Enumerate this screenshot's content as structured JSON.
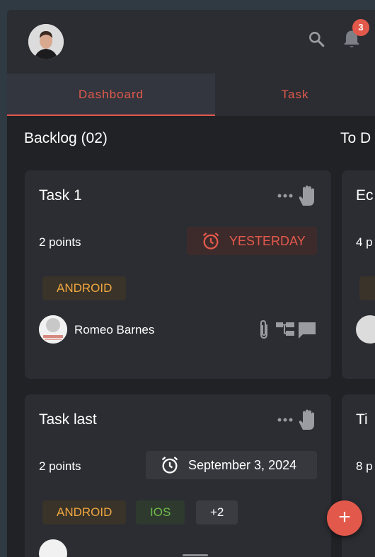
{
  "header": {
    "notification_count": "3",
    "tabs": [
      {
        "label": "Dashboard",
        "active": true
      },
      {
        "label": "Task",
        "active": false
      }
    ]
  },
  "columns": [
    {
      "title": "Backlog (02)"
    },
    {
      "title": "To D"
    }
  ],
  "cards": [
    {
      "title": "Task 1",
      "points": "2 points",
      "due": "YESTERDAY",
      "due_status": "overdue",
      "tags": [
        "ANDROID"
      ],
      "assignee": "Romeo Barnes"
    },
    {
      "title": "Task last",
      "points": "2 points",
      "due": "September 3, 2024",
      "due_status": "normal",
      "tags": [
        "ANDROID",
        "IOS",
        "+2"
      ]
    }
  ],
  "peek_cards": [
    {
      "title": "Ec",
      "points": "4 p"
    },
    {
      "title": "Ti",
      "points": "8 p"
    }
  ],
  "fab_label": "+",
  "colors": {
    "accent": "#e2594c",
    "android": "#f0a840",
    "ios": "#6fbd4b",
    "background": "#202226",
    "card": "#2b2d32"
  },
  "icons": [
    "avatar",
    "search-icon",
    "bell-icon",
    "more-icon",
    "drag-hand-icon",
    "alarm-icon",
    "attachment-icon",
    "subtask-icon",
    "comment-icon",
    "add-icon"
  ]
}
